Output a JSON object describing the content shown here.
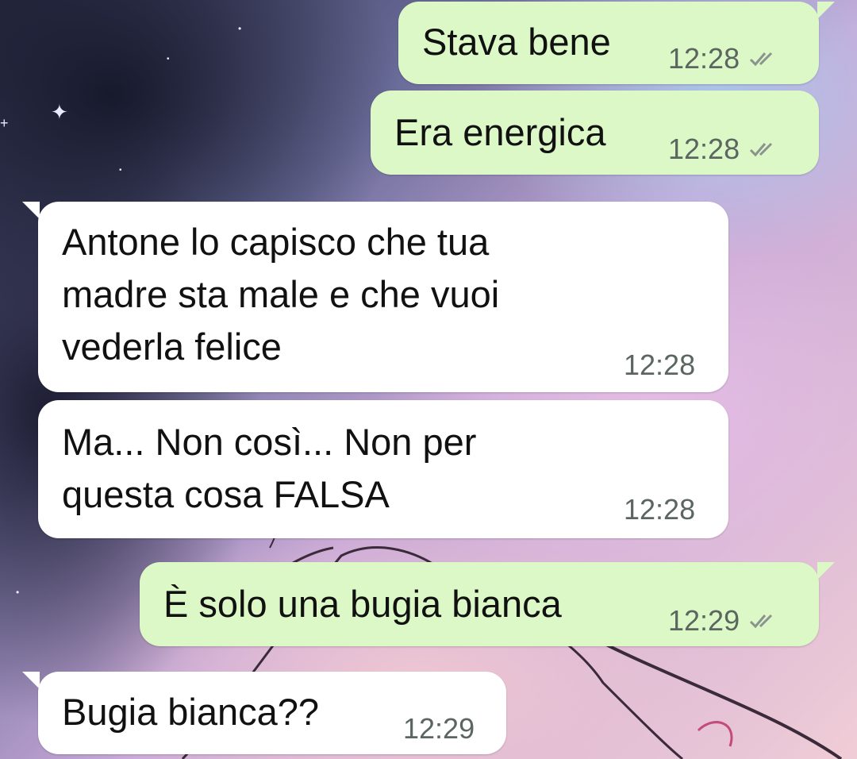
{
  "chat": {
    "messages": [
      {
        "direction": "out",
        "text": "Stava bene",
        "time": "12:28",
        "status": "read-double-check-icon"
      },
      {
        "direction": "out",
        "text": "Era energica",
        "time": "12:28",
        "status": "read-double-check-icon"
      },
      {
        "direction": "in",
        "text": "Antone lo capisco che tua\nmadre sta male e che vuoi\nvederla felice",
        "time": "12:28"
      },
      {
        "direction": "in",
        "text": "Ma... Non così... Non per\nquesta cosa FALSA",
        "time": "12:28"
      },
      {
        "direction": "out",
        "text": "È solo una bugia bianca",
        "time": "12:29",
        "status": "read-double-check-icon"
      },
      {
        "direction": "in",
        "text": "Bugia bianca??",
        "time": "12:29"
      }
    ]
  },
  "colors": {
    "outgoing_bubble": "#dcf8c6",
    "incoming_bubble": "#ffffff",
    "timestamp": "#5c6660"
  }
}
